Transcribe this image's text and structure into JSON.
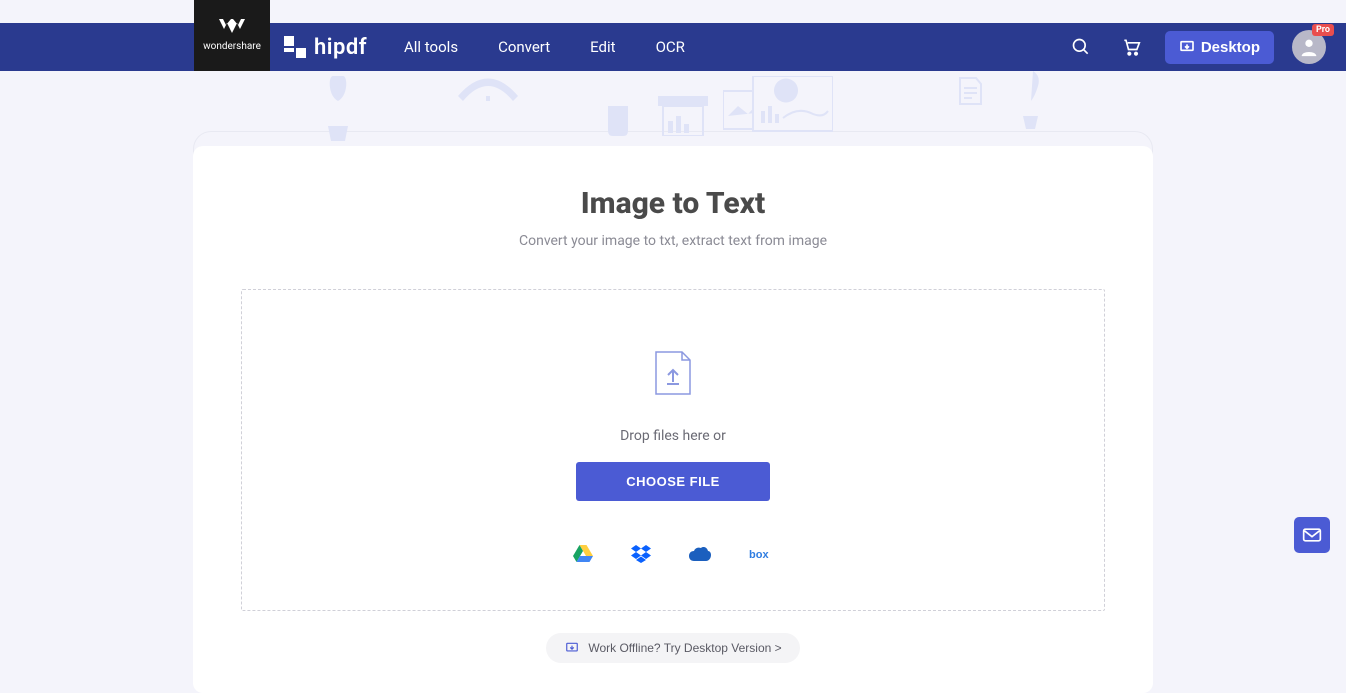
{
  "brand": {
    "wondershare": "wondershare",
    "hipdf": "hipdf"
  },
  "nav": {
    "links": [
      {
        "label": "All tools"
      },
      {
        "label": "Convert"
      },
      {
        "label": "Edit"
      },
      {
        "label": "OCR"
      }
    ],
    "desktop_label": "Desktop",
    "pro_badge": "Pro"
  },
  "page": {
    "title": "Image to Text",
    "subtitle": "Convert your image to txt, extract text from image"
  },
  "dropzone": {
    "drop_text": "Drop files here or",
    "choose_label": "CHOOSE FILE"
  },
  "cloud_sources": [
    "google-drive",
    "dropbox",
    "onedrive",
    "box"
  ],
  "offline_cta": "Work Offline? Try Desktop Version >",
  "colors": {
    "accent": "#4b5bd4",
    "navbar": "#2a3a8f"
  }
}
